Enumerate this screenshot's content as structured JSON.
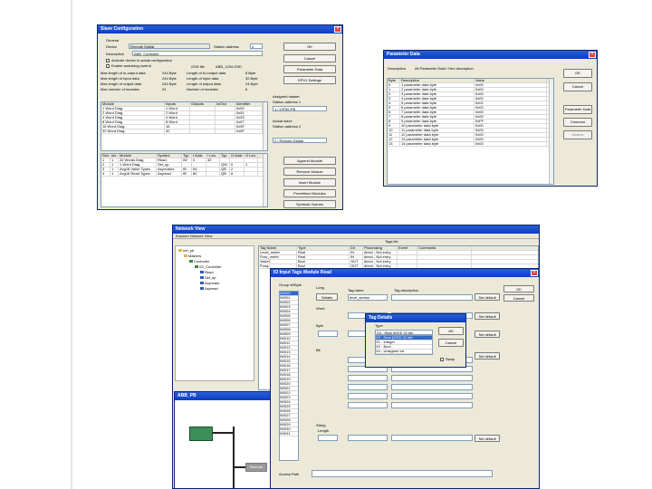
{
  "page": {
    "left_rule_color": "#e4e4e4"
  },
  "slave_config": {
    "title": "Slave Configuration",
    "general_label": "General",
    "device_label": "Device",
    "device_value": "Remote Digital",
    "station_address_label": "Station address",
    "station_address_value": "2",
    "description_label": "Description",
    "description_value": "ABB_Controller",
    "check1": "Activate device in actual configuration",
    "check2": "Enable watchdog control",
    "gsd_text": "GSD file",
    "gsd_value": "ABB_1234.GSD",
    "stats": [
      [
        "Max length of in-output data",
        "244 Byte",
        "Length of in-/output data",
        "8 Byte"
      ],
      [
        "Max length of input data",
        "244 Byte",
        "Length of input data",
        "32 Byte"
      ],
      [
        "Max length of output data",
        "244 Byte",
        "Length of output data",
        "24 Byte"
      ],
      [
        "Max number of modules",
        "24",
        "Number of modules",
        "6"
      ]
    ],
    "buttons": [
      "OK",
      "Cancel",
      "Parameter Data",
      "DPV1 Settings"
    ],
    "modules_header": [
      "Module",
      "Inputs",
      "Outputs",
      "In/Out",
      "Identifier"
    ],
    "modules": [
      [
        "1 Word Diag.",
        "1 Word",
        "",
        "",
        "0x50"
      ],
      [
        "2 Word Diag.",
        "2 Word",
        "",
        "",
        "0x51"
      ],
      [
        "4 Word Diag.",
        "4 Word",
        "",
        "",
        "0x53"
      ],
      [
        "8 Word Diag.",
        "8 Word",
        "",
        "",
        "0x57"
      ],
      [
        "16 Word Diag.",
        "16",
        "",
        "",
        "0x5F"
      ],
      [
        "32 Word Diag.",
        "32",
        "",
        "",
        "0x5F"
      ]
    ],
    "assigned_master_label": "Assigned master",
    "assigned_master_value": "Station address 1",
    "master_combo": "1 / CIF50-PB",
    "actual_slave_label": "Actual slave",
    "actual_slave_value": "Station address 2",
    "slave_combo": "2 / Remote Digital",
    "slot_header": [
      "Slot",
      "Idx",
      "Module",
      "Symbol",
      "Typ",
      "I Addr.",
      "I Len.",
      "Typ",
      "O Addr.",
      "O Len."
    ],
    "slots": [
      [
        "1",
        "1",
        "32 Words Diag.",
        "Read",
        "IW",
        "0",
        "32",
        "",
        "",
        ""
      ],
      [
        "2",
        "1",
        "1 Word Diag.",
        "Set_sp",
        "",
        "",
        "",
        "QW",
        "0",
        "1"
      ],
      [
        "3",
        "1",
        "Avg16 Value Types",
        "Asynvalue",
        "IB",
        "64",
        "",
        "QB",
        "2",
        ""
      ],
      [
        "4",
        "1",
        "Avg16 Read Types",
        "Asyread",
        "IB",
        "80",
        "",
        "QB",
        "6",
        ""
      ]
    ],
    "right_buttons": [
      "Append Module",
      "Remove Module",
      "Insert Module",
      "Predefined Modules",
      "Symbolic Names"
    ]
  },
  "param_data": {
    "title": "Parameter Data",
    "desc_label": "Description",
    "desc_value": "All Parameter Data / Hex description",
    "header": [
      "Byte",
      "Description",
      "Value"
    ],
    "rows": [
      [
        "0",
        "1 parameter data byte",
        "0x00"
      ],
      [
        "1",
        "2 parameter data byte",
        "0x00"
      ],
      [
        "2",
        "3 parameter data byte",
        "0x00"
      ],
      [
        "3",
        "4 parameter data byte",
        "0x00"
      ],
      [
        "4",
        "5 parameter data byte",
        "0x01"
      ],
      [
        "5",
        "6 parameter data byte",
        "0x00"
      ],
      [
        "6",
        "7 parameter data byte",
        "0x00"
      ],
      [
        "7",
        "8 parameter data byte",
        "0x00"
      ],
      [
        "8",
        "9 parameter data byte",
        "0xFF"
      ],
      [
        "9",
        "10 parameter data byte",
        "0x00"
      ],
      [
        "10",
        "11 parameter data byte",
        "0x00"
      ],
      [
        "11",
        "12 parameter data byte",
        "0x00"
      ],
      [
        "12",
        "13 parameter data byte",
        "0x00"
      ],
      [
        "13",
        "14 parameter data byte",
        "0x00"
      ]
    ],
    "buttons": [
      "OK",
      "Cancel",
      "Parameter Data",
      "Common",
      "Module"
    ]
  },
  "network_view": {
    "title": "Network View",
    "menu": "Explorer   Network View",
    "tags_label": "Tags list",
    "tree": [
      "net_pb",
      "Masters",
      "Controller",
      "S2_Controller",
      "Read",
      "Set_sp",
      "Asynvalu",
      "Asyread"
    ],
    "tag_header": [
      "Tag Name",
      "Type",
      "Dir",
      "Processing",
      "Event",
      "Comments"
    ],
    "tags": [
      [
        "Level_meter",
        "Real",
        "IN",
        "direct - Not entry",
        "",
        ""
      ],
      [
        "Flow_meter",
        "Real",
        "IN",
        "direct - Not entry",
        "",
        ""
      ],
      [
        "Valve1",
        "Bool",
        "OUT",
        "direct - Not entry",
        "",
        ""
      ],
      [
        "Pump",
        "Bool",
        "OUT",
        "direct - Not entry",
        "",
        ""
      ]
    ]
  },
  "station_win": {
    "title": "ABB_PB",
    "module_label": "Remote"
  },
  "io_tags": {
    "title": "IO Input Tags  Module Read",
    "group_label": "Group W/Byte",
    "list": [
      "IW000",
      "IW001",
      "IW002",
      "IW003",
      "IW004",
      "IW005",
      "IW006",
      "IW007",
      "IW008",
      "IW009",
      "IW010",
      "IW011",
      "IW012",
      "IW013",
      "IW014",
      "IW015",
      "IW016",
      "IW017",
      "IW018",
      "IW019",
      "IW020",
      "IW021",
      "IW022",
      "IW023",
      "IW024",
      "IW025",
      "IW026",
      "IW027",
      "IW028",
      "IW029",
      "IW030",
      "IW031"
    ],
    "long_label": "Long",
    "tag_name_label": "Tag name",
    "tag_name_value": "level_sensor",
    "tag_desc_label": "Tag description",
    "word_label": "Word",
    "byte_label": "Byte",
    "bit_label": "Bit",
    "string_label": "String",
    "length_label": "Length",
    "access_label": "Access Path",
    "buttons": [
      "Set default",
      "Set default",
      "Set default",
      "Set default",
      "Set default"
    ],
    "ok": "OK",
    "cancel": "Cancel",
    "details_btn": "Details"
  },
  "tag_details": {
    "title": "Tag Details",
    "type_label": "Type",
    "type_value": "X3 - Real (IEEE 32 bit)",
    "options": [
      "X3 - Real (IEEE 32 bit)",
      "X1 - Integer",
      "X2 - Bool",
      "X4 - Unsigned Int"
    ],
    "ok": "OK",
    "cancel": "Cancel",
    "swap": "Swap"
  }
}
